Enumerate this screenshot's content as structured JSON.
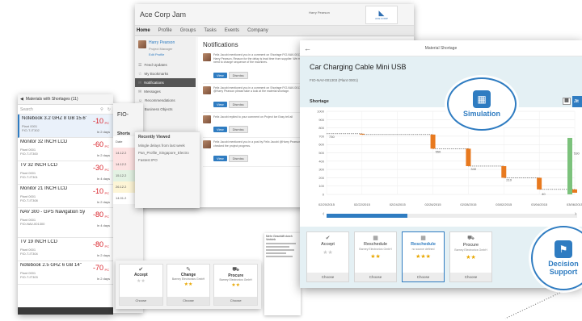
{
  "materials": {
    "title": "Materials with Shortages (11)",
    "search_placeholder": "Search",
    "items": [
      {
        "name": "Notebook 3.2 GHZ 8 GB 15.6\"",
        "value": "-10",
        "unit": "PC",
        "plant": "Plant 0001",
        "id": "FIO-T-IT302",
        "days": "In 2 days"
      },
      {
        "name": "Monitor 32 INCH LCD",
        "value": "-60",
        "unit": "PC",
        "plant": "Plant 0001",
        "id": "FIO-T-IT300",
        "days": "In 2 days"
      },
      {
        "name": "TV 32 INCH LCD",
        "value": "-30",
        "unit": "PC",
        "plant": "Plant 0001",
        "id": "FIO-T-IT301",
        "days": "In 4 days"
      },
      {
        "name": "Monitor 21 INCH LCD",
        "value": "-10",
        "unit": "PC",
        "plant": "Plant 0001",
        "id": "FIO-T-IT308",
        "days": "In 2 days"
      },
      {
        "name": "NAV 300 - GPS Navigation System",
        "value": "-80",
        "unit": "PC",
        "plant": "Plant 0001",
        "id": "FIO-NAV-001300",
        "days": "In 4 days"
      },
      {
        "name": "TV 19 INCH LCD",
        "value": "-80",
        "unit": "PC",
        "plant": "Plant 0001",
        "id": "FIO-T-IT304",
        "days": "In 2 days"
      },
      {
        "name": "Notebook 2.5 GHZ 6 GB 14\"",
        "value": "-70",
        "unit": "PC",
        "plant": "Plant 0001",
        "id": "FIO-T-IT303",
        "days": "In 2 days"
      }
    ]
  },
  "jam": {
    "title": "Ace Corp Jam",
    "user": "Harry Pearson",
    "logo_text": "ACE CORP",
    "nav": [
      "Home",
      "Profile",
      "Groups",
      "Tasks",
      "Events",
      "Company"
    ],
    "profile_name": "Harry Pearson",
    "profile_role": "Project Manager",
    "profile_link": "Edit Profile",
    "side_items": [
      "Feed Updates",
      "My Bookmarks",
      "Notifications",
      "Messages",
      "Recommendations",
      "Business Objects"
    ],
    "notifications_title": "Notifications",
    "notifications": [
      {
        "text": "Felix Jacobi mentioned you in a comment on Shortage FIO-NAV-001303 Hi Harry Pearson, Reason for the delay is lead time from supplier. We might need to change sequence of the machines.",
        "btn1": "View",
        "btn2": "Dismiss"
      },
      {
        "text": "Felix Jacobi mentioned you in a comment on Shortage FIO-NAV-001303 @Harry Pearson please take a look at the material shortage.",
        "btn1": "View",
        "btn2": "Dismiss"
      },
      {
        "text": "Felix Jacobi replied to your comment on Project Ice Easy tell all",
        "btn1": "View",
        "btn2": "Dismiss"
      },
      {
        "text": "Felix Jacobi mentioned you in a post by Felix Jacobi @Harry Pearson I just checked the project progress.",
        "btn1": "View",
        "btn2": "Dismiss"
      }
    ]
  },
  "fio": {
    "title": "FIO-",
    "shortage": "Shorta",
    "date_label": "Date"
  },
  "recent": {
    "title": "Recently Viewed",
    "items": [
      "Mingle delays from last week",
      "Pan_Profile_Singapore_Electro",
      "Fastest IPO"
    ]
  },
  "actions_left": [
    {
      "label": "Accept",
      "sub": "",
      "stars": "★★",
      "empty": true,
      "choose": "Choose"
    },
    {
      "label": "Change",
      "sub": "Barney Electronics GmbH",
      "stars": "★★",
      "empty": false,
      "choose": "Choose"
    },
    {
      "label": "Procure",
      "sub": "Barney Electronics GmbH",
      "stars": "★★",
      "empty": false,
      "choose": "Choose"
    }
  ],
  "doc": {
    "header": "Mehr Geschäft durch Vertrieb"
  },
  "shortage": {
    "window_title": "Material Shortage",
    "title": "Car Charging Cable Mini USB",
    "subtitle": "FIO-NAV-001303 (Plant 0001)",
    "section": "Shortage",
    "tab_label": "Jit",
    "actions": [
      {
        "label": "Accept",
        "sub": "",
        "stars": "★★",
        "empty": true,
        "choose": "Choose",
        "icon": "✔",
        "highlight": false
      },
      {
        "label": "Reschedule",
        "sub": "Barney Electronics GmbH",
        "stars": "★★",
        "empty": false,
        "choose": "Choose",
        "icon": "▦",
        "highlight": false
      },
      {
        "label": "Reschedule",
        "sub": "no source defined",
        "stars": "★★★",
        "empty": false,
        "choose": "Choose",
        "icon": "▦",
        "highlight": true
      },
      {
        "label": "Procure",
        "sub": "Barney Electronics GmbH",
        "stars": "★★",
        "empty": false,
        "choose": "Choose",
        "icon": "⛟",
        "highlight": false
      }
    ]
  },
  "callouts": {
    "simulation": "Simulation",
    "decision_line1": "Decision",
    "decision_line2": "Support"
  },
  "chart_data": {
    "type": "line",
    "title": "",
    "xlabel": "",
    "ylabel": "",
    "ylim": [
      0,
      1000
    ],
    "yticks": [
      0,
      100,
      200,
      300,
      400,
      500,
      600,
      700,
      800,
      900,
      1000
    ],
    "x": [
      "02/20/2015",
      "02/22/2015",
      "02/24/2015",
      "02/26/2015",
      "02/28/2015",
      "03/02/2015",
      "03/04/2015",
      "03/06/2015"
    ],
    "series": [
      {
        "name": "",
        "values": [
          730,
          720,
          720,
          550,
          340,
          200,
          60,
          20
        ]
      }
    ],
    "data_labels": [
      "730",
      "550",
      "340",
      "210",
      "40",
      "530"
    ],
    "grid": true,
    "legend": "none"
  }
}
